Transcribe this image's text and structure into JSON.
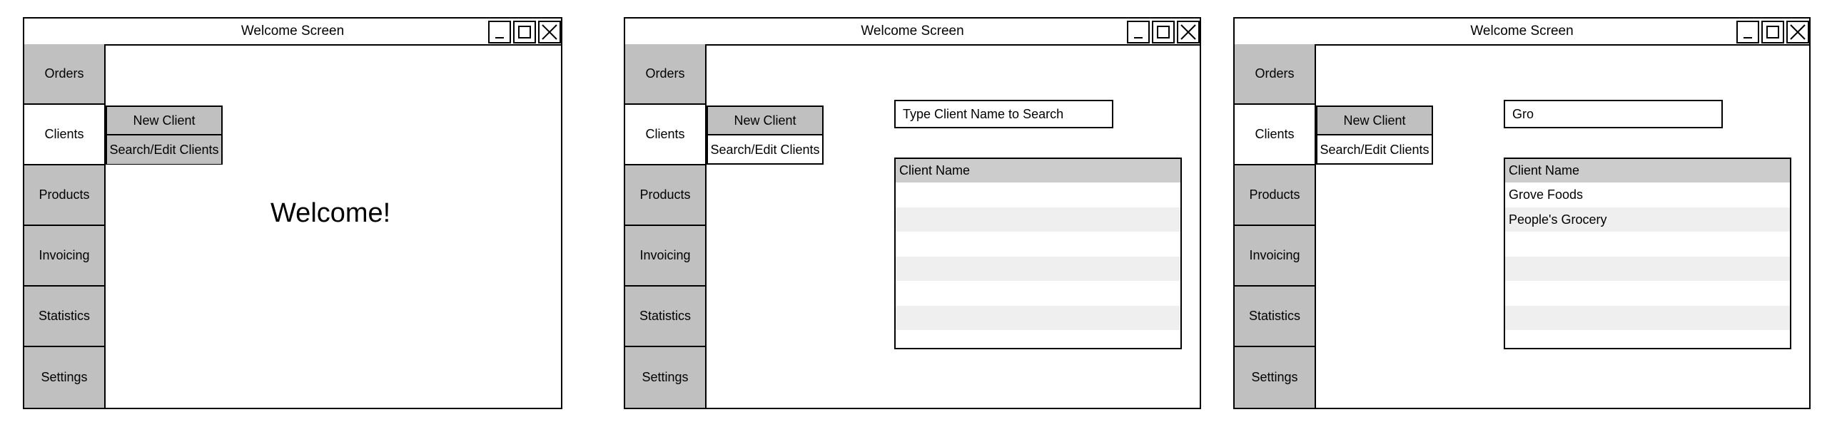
{
  "panels": [
    {
      "window_title": "Welcome Screen",
      "sidebar": [
        "Orders",
        "Clients",
        "Products",
        "Invoicing",
        "Statistics",
        "Settings"
      ],
      "active_item": "Clients",
      "submenu": [
        "New Client",
        "Search/Edit Clients"
      ],
      "submenu_highlighted": "Search/Edit Clients",
      "welcome_text": "Welcome!"
    },
    {
      "window_title": "Welcome Screen",
      "sidebar": [
        "Orders",
        "Clients",
        "Products",
        "Invoicing",
        "Statistics",
        "Settings"
      ],
      "active_item": "Clients",
      "submenu": [
        "New Client",
        "Search/Edit Clients"
      ],
      "submenu_highlighted": "New Client",
      "search_text": "Type Client Name to Search",
      "table_header": "Client Name",
      "rows": []
    },
    {
      "window_title": "Welcome Screen",
      "sidebar": [
        "Orders",
        "Clients",
        "Products",
        "Invoicing",
        "Statistics",
        "Settings"
      ],
      "active_item": "Clients",
      "submenu": [
        "New Client",
        "Search/Edit Clients"
      ],
      "submenu_highlighted": "New Client",
      "search_text": "Gro",
      "table_header": "Client Name",
      "rows": [
        "Grove Foods",
        "People's Grocery"
      ]
    }
  ],
  "colors": {
    "menu_gray": "#c0c0c0",
    "header_gray": "#cccccc",
    "stripe": "#efefef"
  },
  "icons": [
    "minimize-icon",
    "maximize-icon",
    "close-icon"
  ]
}
